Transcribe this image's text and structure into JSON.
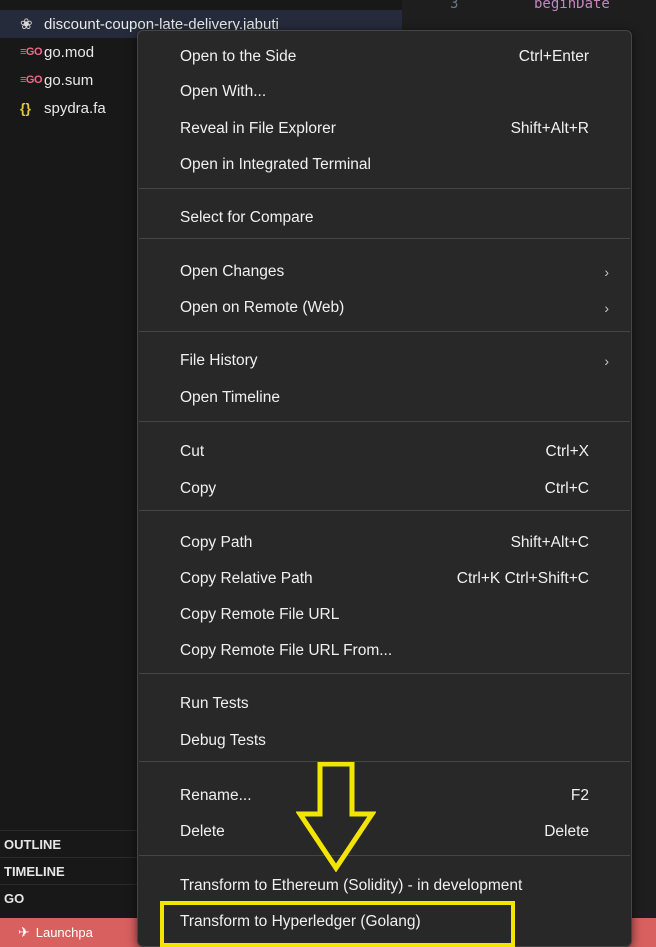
{
  "explorer": {
    "truncated_top_filename": "discount-coupon-late-delivery.jabuti",
    "files": [
      {
        "name": "discount-coupon-late-delivery.jabuti",
        "icon": "gopher-icon"
      },
      {
        "name": "go.mod",
        "icon": "go-file-icon"
      },
      {
        "name": "go.sum",
        "icon": "go-file-icon"
      },
      {
        "name": "spydra.fa",
        "icon": "json-braces-icon"
      }
    ],
    "icon_glyphs": {
      "go": "≡GO",
      "json": "{}",
      "gopher": "❀"
    },
    "sections": [
      "OUTLINE",
      "TIMELINE",
      "GO"
    ]
  },
  "editor": {
    "lines": [
      {
        "num": "3",
        "code": "beginDate"
      },
      {
        "num": "",
        "code": ""
      }
    ]
  },
  "statusbar": {
    "launchpad_label": "Launchpa"
  },
  "context_menu": {
    "items": [
      {
        "label": "Open to the Side",
        "shortcut": "Ctrl+Enter"
      },
      {
        "label": "Open With...",
        "shortcut": ""
      },
      {
        "label": "Reveal in File Explorer",
        "shortcut": "Shift+Alt+R"
      },
      {
        "label": "Open in Integrated Terminal",
        "shortcut": ""
      },
      {
        "label": "Select for Compare",
        "shortcut": ""
      },
      {
        "label": "Open Changes",
        "shortcut": "",
        "submenu": true
      },
      {
        "label": "Open on Remote (Web)",
        "shortcut": "",
        "submenu": true
      },
      {
        "label": "File History",
        "shortcut": "",
        "submenu": true
      },
      {
        "label": "Open Timeline",
        "shortcut": ""
      },
      {
        "label": "Cut",
        "shortcut": "Ctrl+X"
      },
      {
        "label": "Copy",
        "shortcut": "Ctrl+C"
      },
      {
        "label": "Copy Path",
        "shortcut": "Shift+Alt+C"
      },
      {
        "label": "Copy Relative Path",
        "shortcut": "Ctrl+K Ctrl+Shift+C"
      },
      {
        "label": "Copy Remote File URL",
        "shortcut": ""
      },
      {
        "label": "Copy Remote File URL From...",
        "shortcut": ""
      },
      {
        "label": "Run Tests",
        "shortcut": ""
      },
      {
        "label": "Debug Tests",
        "shortcut": ""
      },
      {
        "label": "Rename...",
        "shortcut": "F2"
      },
      {
        "label": "Delete",
        "shortcut": "Delete"
      },
      {
        "label": "Transform to Ethereum (Solidity) - in development",
        "shortcut": ""
      },
      {
        "label": "Transform to Hyperledger (Golang)",
        "shortcut": ""
      }
    ],
    "submenu_glyph": "›"
  },
  "colors": {
    "annotation": "#f2e600",
    "statusbar": "#d8605f",
    "menu_bg": "#282828"
  }
}
